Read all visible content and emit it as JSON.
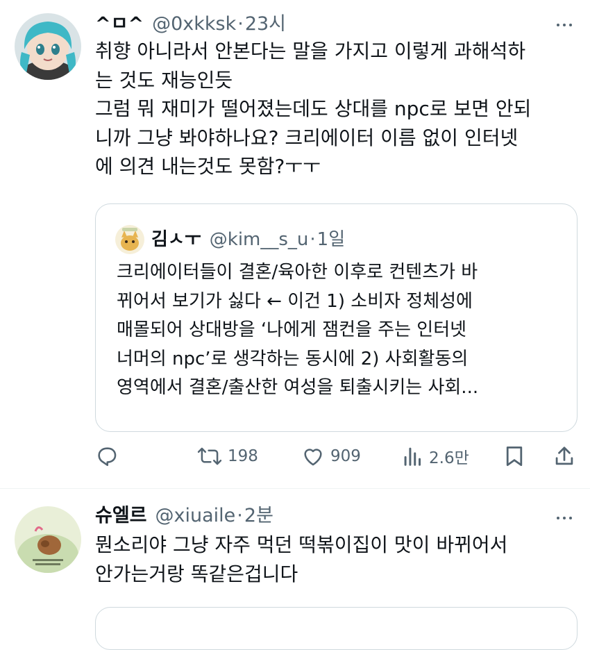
{
  "tweets": [
    {
      "name": "^ㅁ^",
      "handle": "@0xkksk",
      "separator": "·",
      "time": "23시",
      "avatar_icon": "anime-figure-avatar",
      "text": "취향 아니라서 안본다는 말을 가지고 이렇게 과해석하\n는 것도 재능인듯\n그럼 뭐 재미가 떨어졌는데도 상대를 npc로 보면 안되\n니까 그냥 봐야하나요? 크리에이터 이름 없이 인터넷\n에 의견 내는것도 못함?ㅜㅜ",
      "quote": {
        "name": "김ㅅㅜ",
        "handle": "@kim__s_u",
        "separator": "·",
        "time": "1일",
        "avatar_icon": "cartoon-avatar",
        "text": "크리에이터들이 결혼/육아한 이후로 컨텐츠가 바\n뀌어서 보기가 싫다 ← 이건 1) 소비자 정체성에\n매몰되어 상대방을 ‘나에게 잼컨을 주는 인터넷\n너머의 npc’로 생각하는 동시에 2) 사회활동의\n영역에서 결혼/출산한 여성을 퇴출시키는 사회..."
      },
      "stats": {
        "retweets": "198",
        "likes": "909",
        "views": "2.6만"
      }
    },
    {
      "name": "슈엘르",
      "handle": "@xiuaile",
      "separator": "·",
      "time": "2분",
      "avatar_icon": "illustrated-avatar",
      "text": "뭔소리야 그냥 자주 먹던 떡볶이집이 맛이 바뀌어서\n안가는거랑 똑같은겁니다"
    }
  ],
  "icons": {
    "reply": "reply-icon",
    "retweet": "retweet-icon",
    "like": "heart-icon",
    "views": "views-chart-icon",
    "bookmark": "bookmark-icon",
    "share": "share-icon",
    "more": "more-icon"
  },
  "colors": {
    "text": "#0f1419",
    "secondary": "#536471",
    "border": "#cfd9de"
  }
}
